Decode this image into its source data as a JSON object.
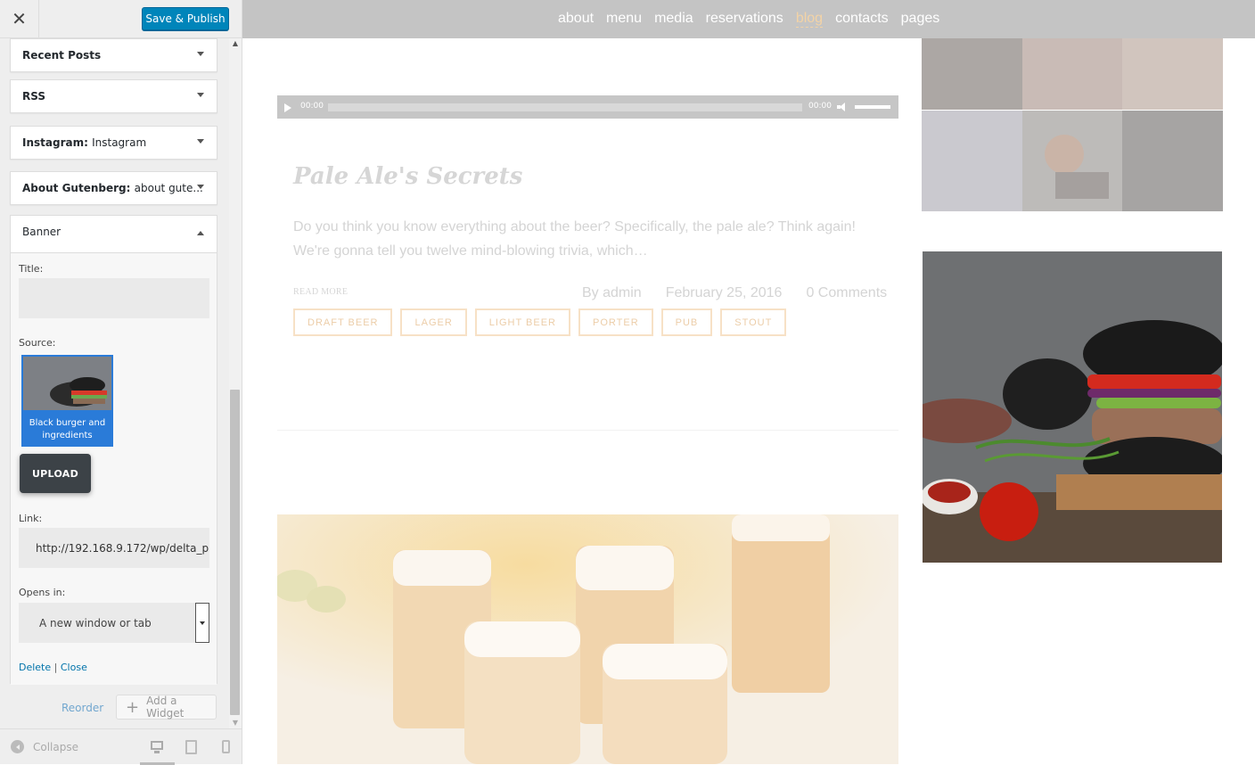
{
  "header": {
    "close_icon": "close-icon",
    "publish_label": "Save & Publish"
  },
  "widgets": [
    {
      "title": "Recent Posts",
      "subtitle": ""
    },
    {
      "title": "RSS",
      "subtitle": ""
    },
    {
      "title": "Instagram:",
      "subtitle": "Instagram"
    },
    {
      "title": "About Gutenberg:",
      "subtitle": "about gute..."
    }
  ],
  "banner": {
    "title": "Banner",
    "title_label": "Title:",
    "title_value": "",
    "source_label": "Source:",
    "source_caption": "Black burger and ingredients",
    "upload_label": "UPLOAD",
    "link_label": "Link:",
    "link_value": "http://192.168.9.172/wp/delta_p",
    "opens_label": "Opens in:",
    "opens_value": "A new window or tab",
    "delete_label": "Delete",
    "separator": "|",
    "close_label": "Close"
  },
  "actions": {
    "reorder_label": "Reorder",
    "add_widget_label": "Add a Widget"
  },
  "footer": {
    "collapse_label": "Collapse",
    "devices": [
      "desktop",
      "tablet",
      "mobile"
    ]
  },
  "site": {
    "nav": [
      {
        "label": "about",
        "active": false
      },
      {
        "label": "menu",
        "active": false
      },
      {
        "label": "media",
        "active": false
      },
      {
        "label": "reservations",
        "active": false
      },
      {
        "label": "blog",
        "active": true
      },
      {
        "label": "contacts",
        "active": false
      },
      {
        "label": "pages",
        "active": false
      }
    ],
    "audio": {
      "current": "00:00",
      "duration": "00:00"
    },
    "post": {
      "title": "Pale Ale's Secrets",
      "excerpt": "Do you think you know everything about the beer? Specifically, the pale ale? Think again! We're gonna tell you twelve mind-blowing trivia, which…",
      "read_more": "READ MORE",
      "author": "By admin",
      "date": "February 25, 2016",
      "comments": "0 Comments",
      "tags": [
        "DRAFT BEER",
        "LAGER",
        "LIGHT BEER",
        "PORTER",
        "PUB",
        "STOUT"
      ]
    }
  },
  "colors": {
    "publish": "#0085ba",
    "nav_bg": "#c4c4c4",
    "nav_active": "#f3d3a6",
    "tag_border": "#f7e1c6",
    "selected_image_border": "#2a7bd8"
  }
}
